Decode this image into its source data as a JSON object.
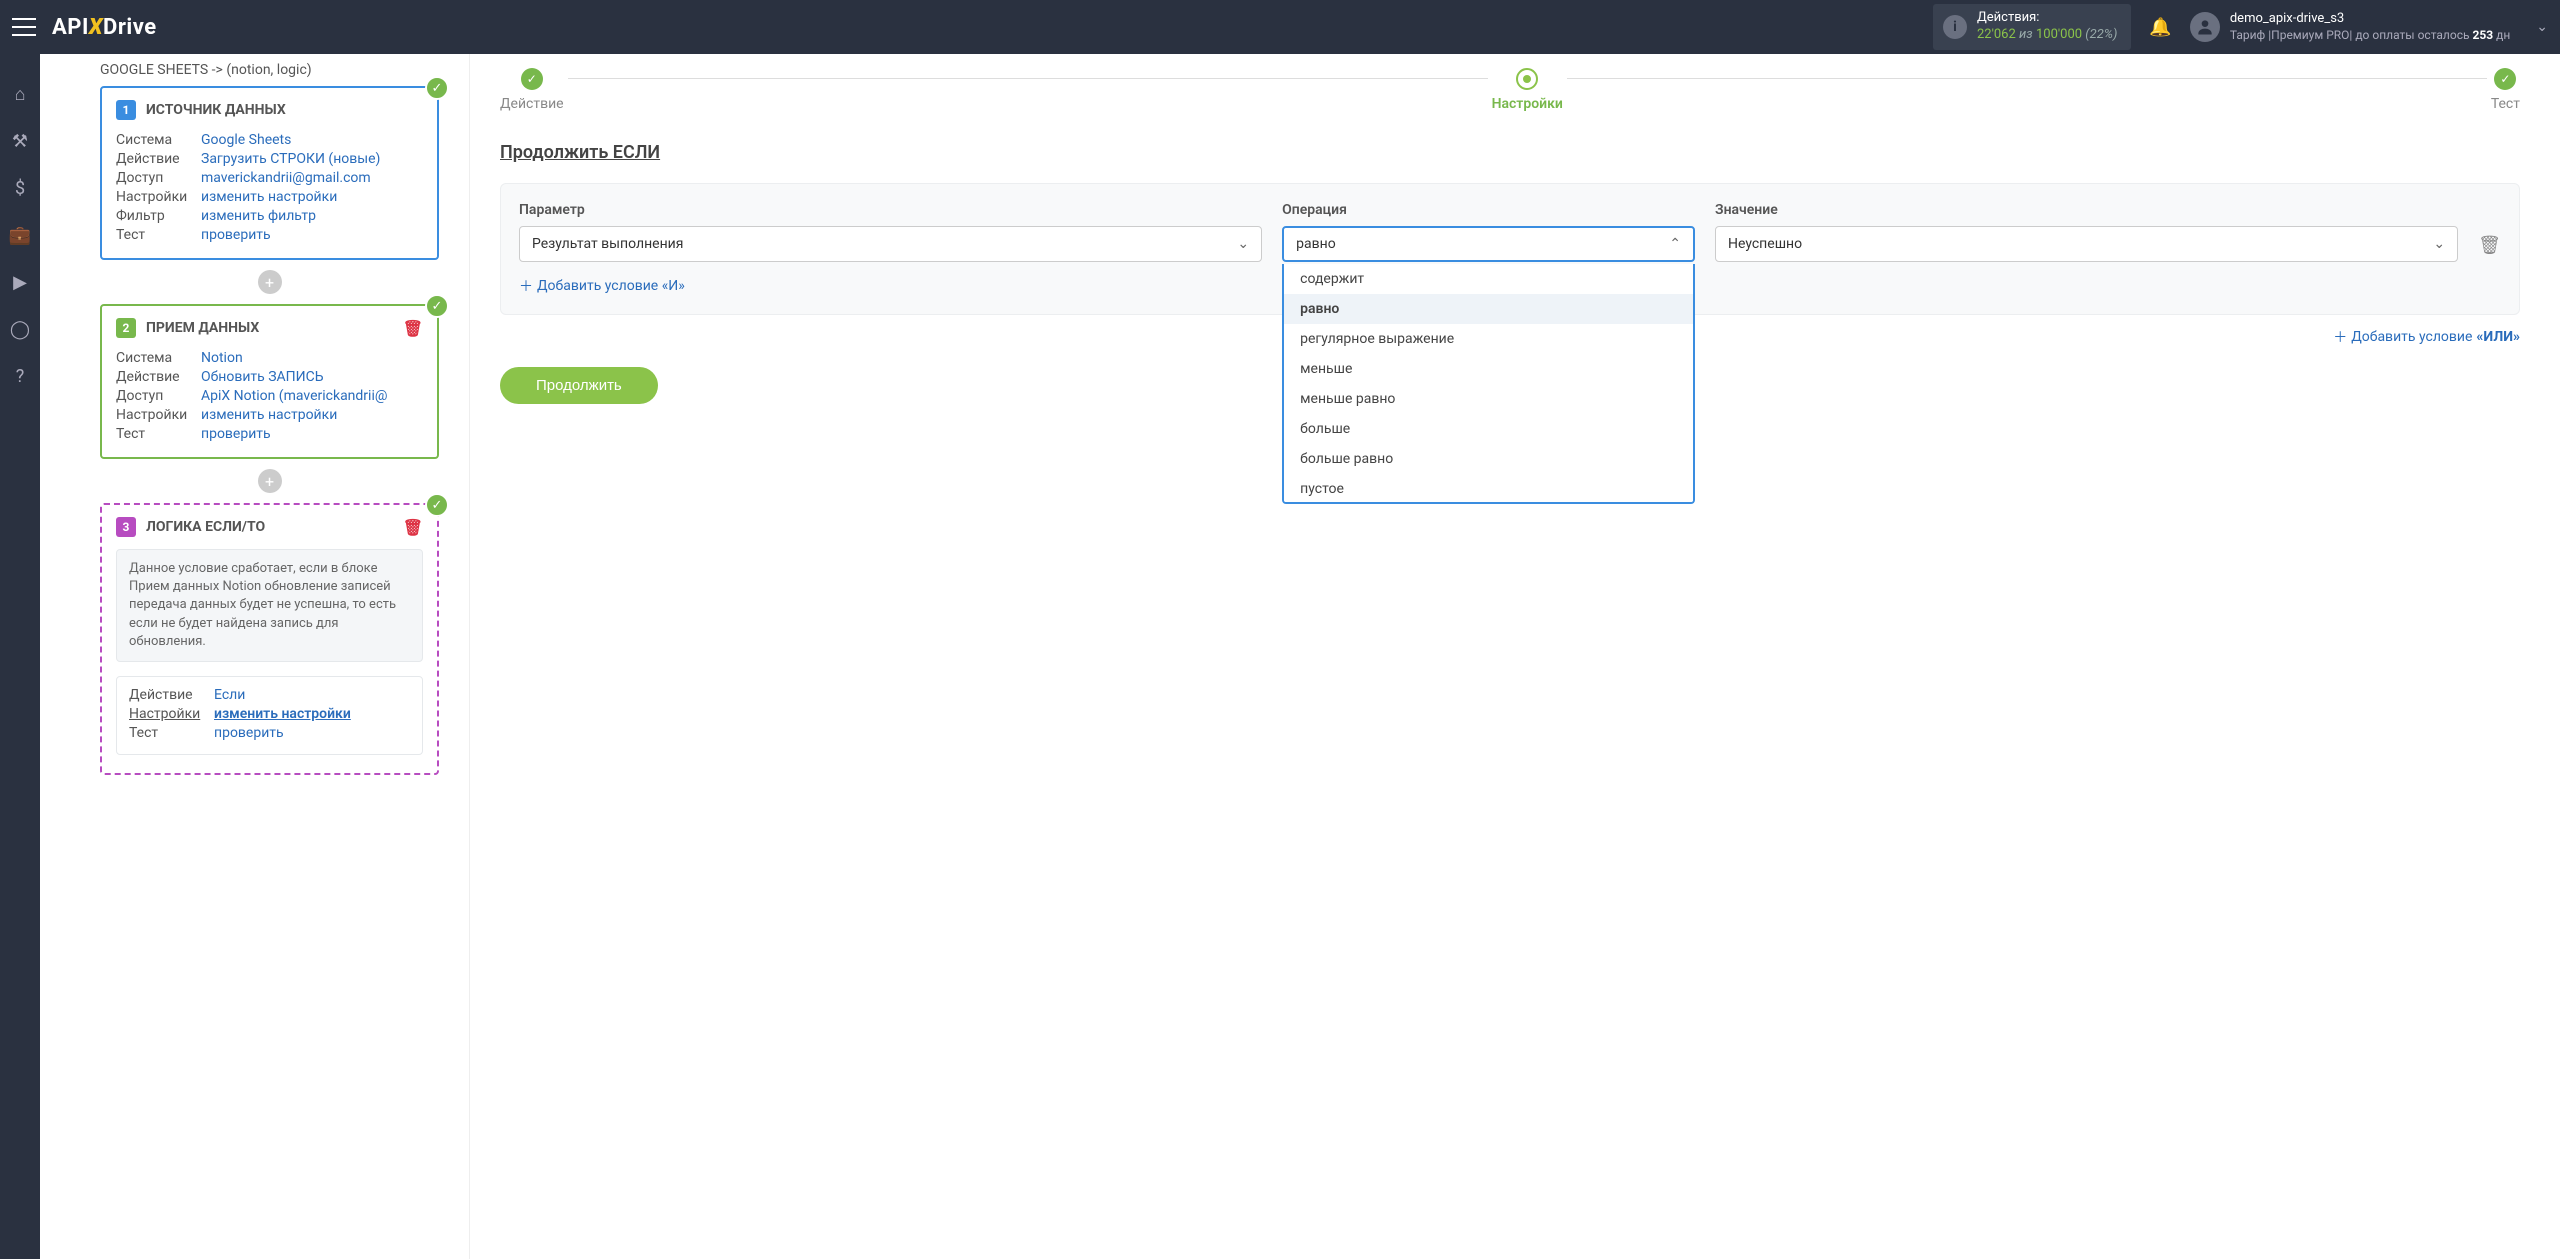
{
  "header": {
    "logo_api": "API",
    "logo_drive": "Drive",
    "actions_label": "Действия:",
    "actions_used": "22'062",
    "actions_sep": "из",
    "actions_total": "100'000",
    "actions_pct": "(22%)",
    "username": "demo_apix-drive_s3",
    "tariff_prefix": "Тариф |Премиум PRO| до оплаты осталось ",
    "tariff_days": "253",
    "tariff_suffix": " дн"
  },
  "breadcrumb": "GOOGLE SHEETS -> (notion, logic)",
  "source": {
    "title": "ИСТОЧНИК ДАННЫХ",
    "rows": {
      "system_l": "Система",
      "system_v": "Google Sheets",
      "action_l": "Действие",
      "action_v": "Загрузить СТРОКИ (новые)",
      "access_l": "Доступ",
      "access_v": "maverickandrii@gmail.com",
      "settings_l": "Настройки",
      "settings_v": "изменить настройки",
      "filter_l": "Фильтр",
      "filter_v": "изменить фильтр",
      "test_l": "Тест",
      "test_v": "проверить"
    }
  },
  "dest": {
    "title": "ПРИЕМ ДАННЫХ",
    "rows": {
      "system_l": "Система",
      "system_v": "Notion",
      "action_l": "Действие",
      "action_v": "Обновить ЗАПИСЬ",
      "access_l": "Доступ",
      "access_v": "ApiX Notion (maverickandrii@",
      "settings_l": "Настройки",
      "settings_v": "изменить настройки",
      "test_l": "Тест",
      "test_v": "проверить"
    }
  },
  "logic": {
    "title": "ЛОГИКА ЕСЛИ/ТО",
    "desc": "Данное условие сработает, если в блоке Прием данных Notion обновление записей передача данных будет не успешна, то есть если не будет найдена запись для обновления.",
    "rows": {
      "action_l": "Действие",
      "action_v": "Если",
      "settings_l": "Настройки",
      "settings_v": "изменить настройки",
      "test_l": "Тест",
      "test_v": "проверить"
    }
  },
  "steps": {
    "s1": "Действие",
    "s2": "Настройки",
    "s3": "Тест"
  },
  "section_title": "Продолжить ЕСЛИ",
  "cond": {
    "param_label": "Параметр",
    "op_label": "Операция",
    "val_label": "Значение",
    "param_value": "Результат выполнения",
    "op_value": "равно",
    "val_value": "Неуспешно",
    "add_and": "Добавить условие «И»",
    "add_or_prefix": "Добавить условие ",
    "add_or_bold": "«ИЛИ»"
  },
  "dropdown_options": [
    "содержит",
    "равно",
    "регулярное выражение",
    "меньше",
    "меньше равно",
    "больше",
    "больше равно",
    "пустое"
  ],
  "dropdown_selected": "равно",
  "continue_label": "Продолжить"
}
